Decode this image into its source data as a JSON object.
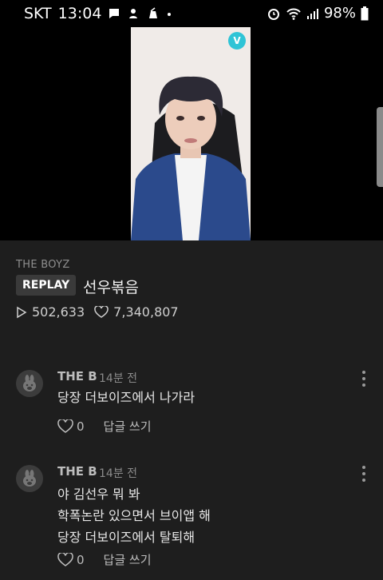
{
  "statusbar": {
    "carrier": "SKT",
    "time": "13:04",
    "battery": "98%"
  },
  "video": {
    "watermark": "V"
  },
  "channel": {
    "name": "THE BOYZ"
  },
  "post": {
    "badge": "REPLAY",
    "title": "선우볶음",
    "views": "502,633",
    "likes": "7,340,807"
  },
  "comments": [
    {
      "author": "THE B",
      "time": "14분 전",
      "lines": [
        "당장 더보이즈에서 나가라"
      ],
      "likes": "0",
      "reply_label": "답글 쓰기"
    },
    {
      "author": "THE B",
      "time": "14분 전",
      "lines": [
        "야 김선우 뭐 봐",
        "학폭논란 있으면서 브이앱 해",
        "당장 더보이즈에서 탈퇴해"
      ],
      "likes": "0",
      "reply_label": "답글 쓰기"
    }
  ],
  "icons": {
    "statusbar": [
      "message-icon",
      "notification-icon",
      "recycle-icon",
      "alarm-icon",
      "wifi-icon",
      "signal-icon",
      "battery-icon"
    ],
    "stats": [
      "play-icon",
      "heart-icon"
    ],
    "comment": [
      "avatar-icon",
      "more-icon",
      "heart-icon"
    ]
  }
}
